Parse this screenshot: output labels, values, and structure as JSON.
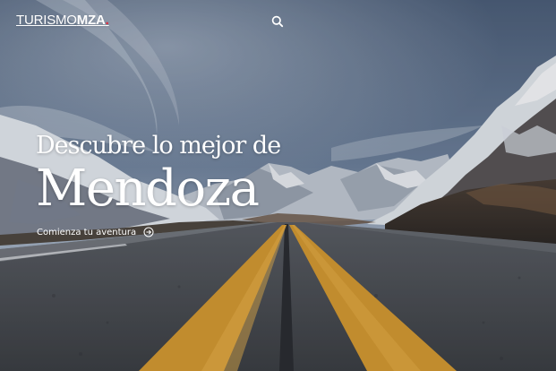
{
  "header": {
    "logo": {
      "part_thin": "TURISMO",
      "part_bold": "MZA",
      "part_dot": "."
    },
    "search_icon": "search-icon"
  },
  "hero": {
    "headline_small": "Descubre lo mejor de",
    "headline_big": "Mendoza",
    "cta_label": "Comienza tu aventura",
    "cta_icon": "arrow-right-circle-icon"
  },
  "colors": {
    "accent_dot": "#e3263a",
    "text": "#ffffff",
    "road_line": "#d99b2e"
  }
}
